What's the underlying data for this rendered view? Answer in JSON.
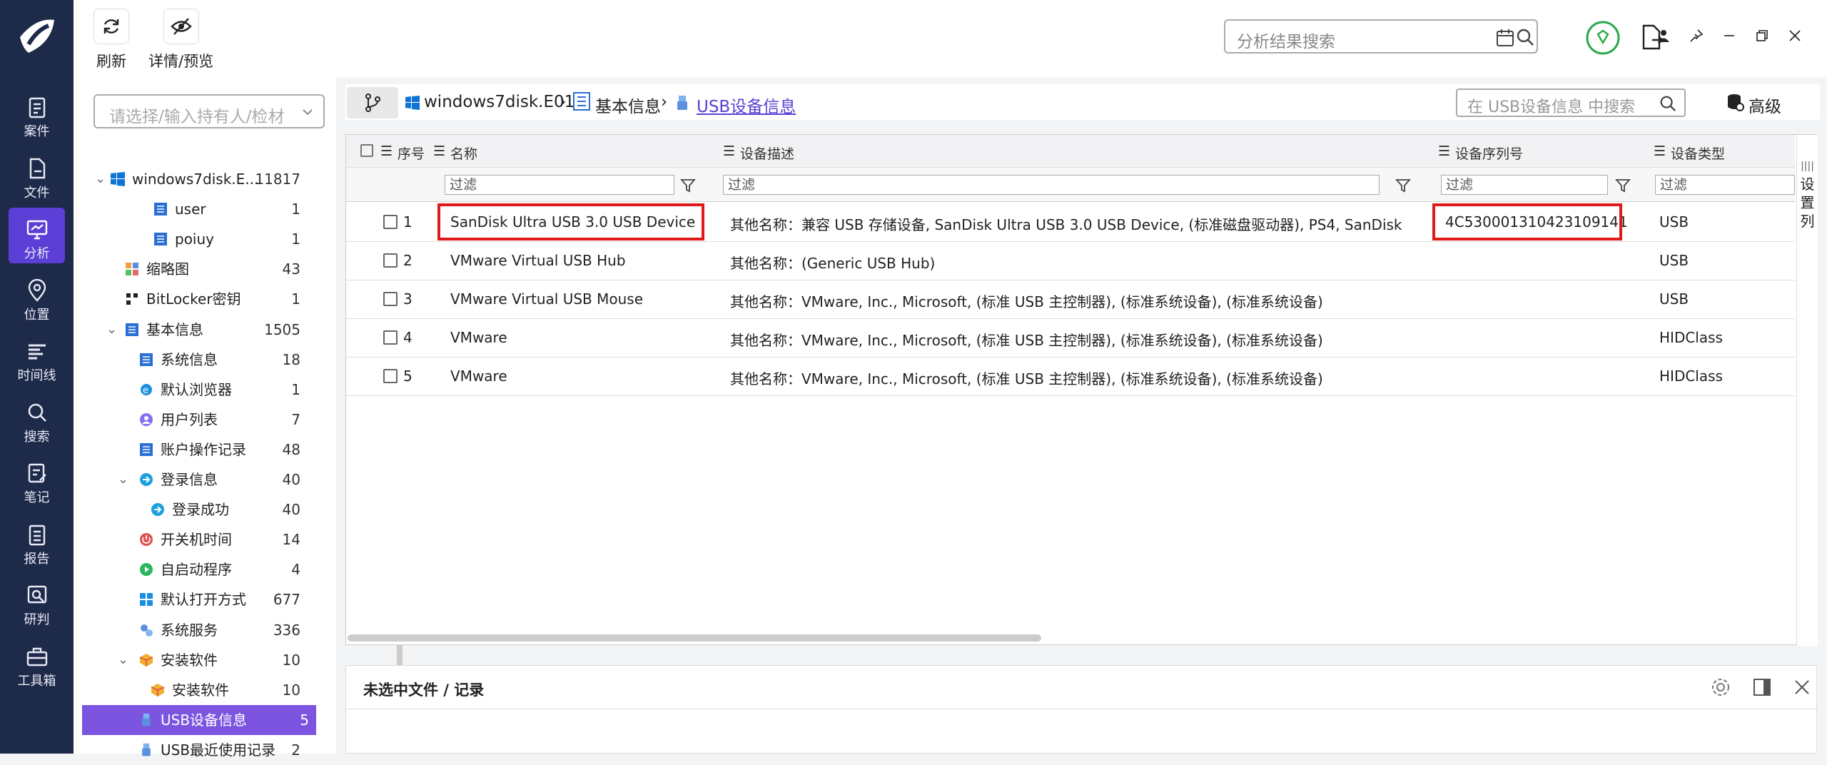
{
  "nav": [
    {
      "label": "案件",
      "icon": "clipboard-icon"
    },
    {
      "label": "文件",
      "icon": "file-icon"
    },
    {
      "label": "分析",
      "icon": "monitor-icon",
      "active": true
    },
    {
      "label": "位置",
      "icon": "location-icon"
    },
    {
      "label": "时间线",
      "icon": "timeline-icon"
    },
    {
      "label": "搜索",
      "icon": "search-icon"
    },
    {
      "label": "笔记",
      "icon": "note-icon"
    },
    {
      "label": "报告",
      "icon": "report-icon"
    },
    {
      "label": "研判",
      "icon": "analysis-icon"
    },
    {
      "label": "工具箱",
      "icon": "toolbox-icon"
    }
  ],
  "toolbar": {
    "refresh": "刷新",
    "details": "详情/预览",
    "search_placeholder": "分析结果搜索"
  },
  "left": {
    "combo_placeholder": "请选择/输入持有人/检材",
    "tree": [
      {
        "label": "windows7disk.E...",
        "count": "11817",
        "icon": "windows-icon"
      },
      {
        "label": "user",
        "count": "1",
        "icon": "list-icon"
      },
      {
        "label": "poiuy",
        "count": "1",
        "icon": "list-icon"
      },
      {
        "label": "缩略图",
        "count": "43",
        "icon": "thumbnail-icon"
      },
      {
        "label": "BitLocker密钥",
        "count": "1",
        "icon": "key-icon"
      },
      {
        "label": "基本信息",
        "count": "1505",
        "icon": "list-icon"
      },
      {
        "label": "系统信息",
        "count": "18",
        "icon": "list-icon"
      },
      {
        "label": "默认浏览器",
        "count": "1",
        "icon": "ie-icon"
      },
      {
        "label": "用户列表",
        "count": "7",
        "icon": "user-icon"
      },
      {
        "label": "账户操作记录",
        "count": "48",
        "icon": "list-icon"
      },
      {
        "label": "登录信息",
        "count": "40",
        "icon": "login-icon"
      },
      {
        "label": "登录成功",
        "count": "40",
        "icon": "login-icon"
      },
      {
        "label": "开关机时间",
        "count": "14",
        "icon": "power-icon"
      },
      {
        "label": "自启动程序",
        "count": "4",
        "icon": "play-icon"
      },
      {
        "label": "默认打开方式",
        "count": "677",
        "icon": "apps-icon"
      },
      {
        "label": "系统服务",
        "count": "336",
        "icon": "service-icon"
      },
      {
        "label": "安装软件",
        "count": "10",
        "icon": "box-icon"
      },
      {
        "label": "安装软件",
        "count": "10",
        "icon": "box-icon"
      },
      {
        "label": "USB设备信息",
        "count": "5",
        "icon": "usb-icon",
        "selected": true
      },
      {
        "label": "USB最近使用记录",
        "count": "2",
        "icon": "usb-icon"
      }
    ]
  },
  "breadcrumb": {
    "disk": "windows7disk.E01",
    "basic": "基本信息",
    "usb": "USB设备信息",
    "search_placeholder": "在 USB设备信息 中搜索",
    "advanced": "高级"
  },
  "grid": {
    "columns": [
      "序号",
      "名称",
      "设备描述",
      "设备序列号",
      "设备类型"
    ],
    "filter": "过滤",
    "settings": "设置列",
    "rows": [
      {
        "n": "1",
        "name": "SanDisk Ultra USB 3.0 USB Device",
        "desc": "其他名称：兼容 USB 存储设备, SanDisk Ultra USB 3.0 USB Device, (标准磁盘驱动器), PS4, SanDisk",
        "serial": "4C530001310423109141",
        "type": "USB"
      },
      {
        "n": "2",
        "name": "VMware Virtual USB Hub",
        "desc": "其他名称：(Generic USB Hub)",
        "serial": "",
        "type": "USB"
      },
      {
        "n": "3",
        "name": "VMware Virtual USB Mouse",
        "desc": "其他名称：VMware, Inc., Microsoft, (标准 USB 主控制器), (标准系统设备), (标准系统设备)",
        "serial": "",
        "type": "USB"
      },
      {
        "n": "4",
        "name": "VMware",
        "desc": "其他名称：VMware, Inc., Microsoft, (标准 USB 主控制器), (标准系统设备), (标准系统设备)",
        "serial": "",
        "type": "HIDClass"
      },
      {
        "n": "5",
        "name": "VMware",
        "desc": "其他名称：VMware, Inc., Microsoft, (标准 USB 主控制器), (标准系统设备), (标准系统设备)",
        "serial": "",
        "type": "HIDClass"
      }
    ]
  },
  "bottom": {
    "title": "未选中文件 / 记录"
  }
}
